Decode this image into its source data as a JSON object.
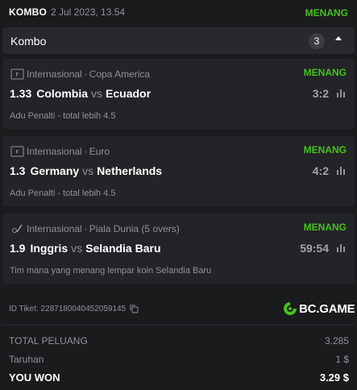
{
  "header": {
    "type": "KOMBO",
    "date": "2 Jul 2023, 13.54",
    "status": "MENANG"
  },
  "kombo": {
    "label": "Kombo",
    "count": "3"
  },
  "bets": [
    {
      "league": "Internasional",
      "tournament": "Copa America",
      "status": "MENANG",
      "odd": "1.33",
      "home": "Colombia",
      "vs": "vs",
      "away": "Ecuador",
      "score": "3:2",
      "market": "Adu Penalti - total lebih 4.5"
    },
    {
      "league": "Internasional",
      "tournament": "Euro",
      "status": "MENANG",
      "odd": "1.3",
      "home": "Germany",
      "vs": "vs",
      "away": "Netherlands",
      "score": "4:2",
      "market": "Adu Penalti - total lebih 4.5"
    },
    {
      "league": "Internasional",
      "tournament": "Piala Dunia (5 overs)",
      "status": "MENANG",
      "odd": "1.9",
      "home": "Inggris",
      "vs": "vs",
      "away": "Selandia Baru",
      "score": "59:54",
      "market": "Tim mana yang menang lempar koin Selandia Baru"
    }
  ],
  "ticket": {
    "label": "ID Tiket: 2287180040452059145"
  },
  "brand": {
    "name": "BC.GAME"
  },
  "summary": {
    "total_label": "TOTAL PELUANG",
    "total_value": "3.285",
    "stake_label": "Taruhan",
    "stake_value": "1 $",
    "won_label": "YOU WON",
    "won_value": "3.29 $"
  },
  "colors": {
    "win": "#46c11f",
    "background": "#1a1b1d",
    "card": "#232427"
  }
}
